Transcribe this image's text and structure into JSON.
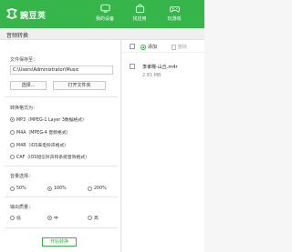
{
  "app": {
    "name": "豌豆荚",
    "brand_color": "#35b54a"
  },
  "nav": [
    {
      "label": "我的设备",
      "icon": "device-icon"
    },
    {
      "label": "找应用",
      "icon": "shopping-bag-icon"
    },
    {
      "label": "玩游戏",
      "icon": "gamepad-icon"
    }
  ],
  "panel": {
    "title": "音频转换"
  },
  "save_location": {
    "label": "文件保存至：",
    "path": "C:\\Users\\Administrator\\Music",
    "choose_button": "选择...",
    "open_folder_button": "打开文件夹"
  },
  "format": {
    "label": "转换格式为：",
    "options": [
      "MP3（MPEG-1 Layer 3数据格式）",
      "M4A（MPEG-4 音频格式）",
      "M4R（iOS来电铃声格式）",
      "CAF（iOS短信铃声和系统音效格式）"
    ],
    "selected_index": 0
  },
  "volume": {
    "label": "音量选择：",
    "options": [
      "50%",
      "100%",
      "200%"
    ],
    "selected_index": 1
  },
  "quality": {
    "label": "输出质量：",
    "options": [
      "低",
      "中",
      "高"
    ],
    "selected_index": 1
  },
  "convert_button": "开始转换",
  "file_list": {
    "add_label": "添加",
    "delete_label": "删除",
    "items": [
      {
        "name": "李孝瞳-山丘.m4r",
        "size": "2.81 MB"
      }
    ]
  }
}
